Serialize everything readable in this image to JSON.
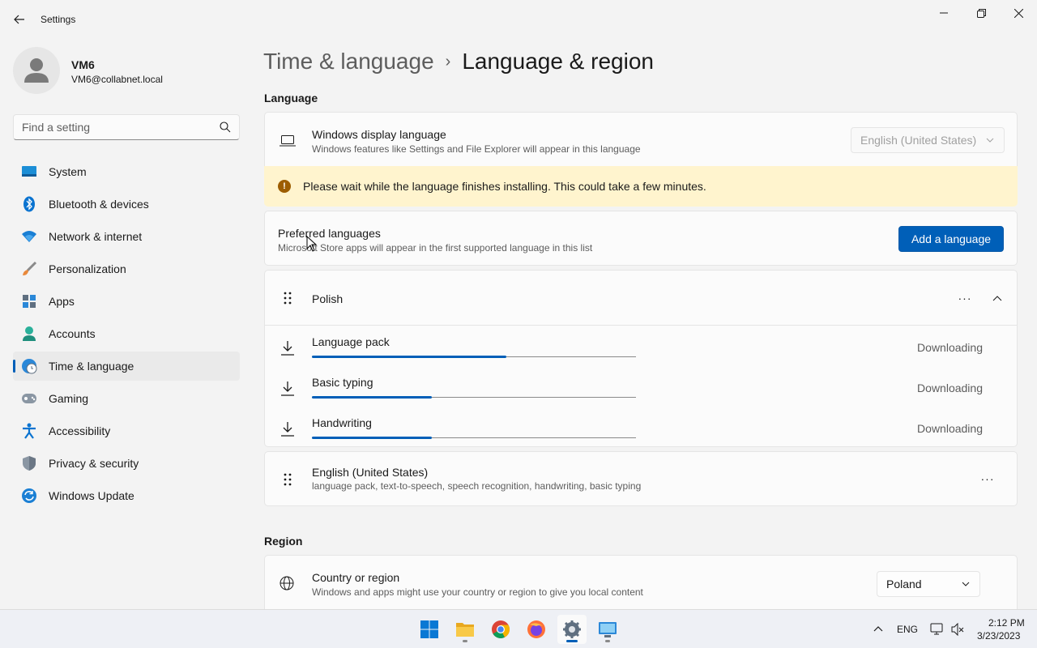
{
  "window": {
    "title": "Settings",
    "back_icon": "back-arrow-icon",
    "controls": [
      "minimize-icon",
      "restore-icon",
      "close-icon"
    ]
  },
  "profile": {
    "name": "VM6",
    "email": "VM6@collabnet.local"
  },
  "search": {
    "placeholder": "Find a setting"
  },
  "sidebar": {
    "items": [
      {
        "label": "System",
        "icon": "system-icon"
      },
      {
        "label": "Bluetooth & devices",
        "icon": "bluetooth-icon"
      },
      {
        "label": "Network & internet",
        "icon": "wifi-icon"
      },
      {
        "label": "Personalization",
        "icon": "brush-icon"
      },
      {
        "label": "Apps",
        "icon": "apps-icon"
      },
      {
        "label": "Accounts",
        "icon": "account-icon"
      },
      {
        "label": "Time & language",
        "icon": "globe-clock-icon",
        "active": true
      },
      {
        "label": "Gaming",
        "icon": "gamepad-icon"
      },
      {
        "label": "Accessibility",
        "icon": "accessibility-icon"
      },
      {
        "label": "Privacy & security",
        "icon": "shield-icon"
      },
      {
        "label": "Windows Update",
        "icon": "update-icon"
      }
    ]
  },
  "breadcrumb": {
    "parent": "Time & language",
    "separator": "›",
    "current": "Language & region"
  },
  "language_section": {
    "title": "Language",
    "display_language": {
      "title": "Windows display language",
      "description": "Windows features like Settings and File Explorer will appear in this language",
      "selected": "English (United States)"
    },
    "warning": {
      "icon": "!",
      "text": "Please wait while the language finishes installing. This could take a few minutes."
    },
    "preferred": {
      "title": "Preferred languages",
      "description": "Microsoft Store apps will appear in the first supported language in this list",
      "button": "Add a language"
    },
    "languages": [
      {
        "name": "Polish",
        "more": "···",
        "downloads": [
          {
            "name": "Language pack",
            "status": "Downloading",
            "progress": 0.6
          },
          {
            "name": "Basic typing",
            "status": "Downloading",
            "progress": 0.37
          },
          {
            "name": "Handwriting",
            "status": "Downloading",
            "progress": 0.37
          }
        ]
      },
      {
        "name": "English (United States)",
        "description": "language pack, text-to-speech, speech recognition, handwriting, basic typing",
        "more": "···"
      }
    ]
  },
  "region_section": {
    "title": "Region",
    "country": {
      "title": "Country or region",
      "description": "Windows and apps might use your country or region to give you local content",
      "selected": "Poland"
    }
  },
  "taskbar": {
    "apps": [
      "windows-start-icon",
      "file-explorer-icon",
      "chrome-icon",
      "firefox-icon",
      "settings-icon",
      "remote-desktop-icon"
    ],
    "input_language": "ENG",
    "time": "2:12 PM",
    "date": "3/23/2023"
  },
  "colors": {
    "accent": "#005fb8",
    "warning_bg": "#fff4ce",
    "warning_icon": "#9d5d00"
  }
}
